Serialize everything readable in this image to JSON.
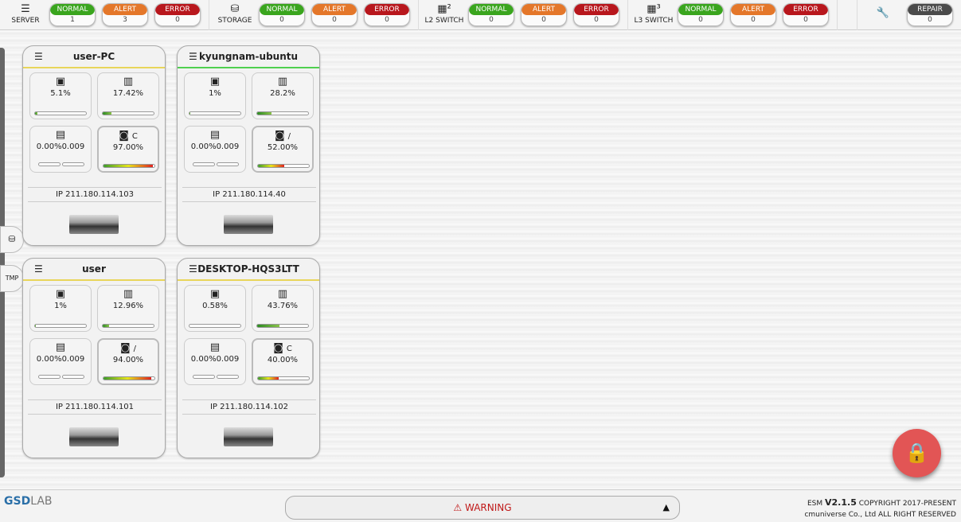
{
  "topbar": {
    "groups": [
      {
        "label": "SERVER",
        "icon": "server-icon",
        "glyph": "☰",
        "counts": [
          {
            "label": "NORMAL",
            "value": "1",
            "cls": "n"
          },
          {
            "label": "ALERT",
            "value": "3",
            "cls": "a"
          },
          {
            "label": "ERROR",
            "value": "0",
            "cls": "e"
          }
        ]
      },
      {
        "label": "STORAGE",
        "icon": "storage-icon",
        "glyph": "⛁",
        "counts": [
          {
            "label": "NORMAL",
            "value": "0",
            "cls": "n"
          },
          {
            "label": "ALERT",
            "value": "0",
            "cls": "a"
          },
          {
            "label": "ERROR",
            "value": "0",
            "cls": "e"
          }
        ]
      },
      {
        "label": "L2 SWITCH",
        "icon": "switch-l2-icon",
        "glyph": "▦²",
        "counts": [
          {
            "label": "NORMAL",
            "value": "0",
            "cls": "n"
          },
          {
            "label": "ALERT",
            "value": "0",
            "cls": "a"
          },
          {
            "label": "ERROR",
            "value": "0",
            "cls": "e"
          }
        ]
      },
      {
        "label": "L3 SWITCH",
        "icon": "switch-l3-icon",
        "glyph": "▦³",
        "counts": [
          {
            "label": "NORMAL",
            "value": "0",
            "cls": "n"
          },
          {
            "label": "ALERT",
            "value": "0",
            "cls": "a"
          },
          {
            "label": "ERROR",
            "value": "0",
            "cls": "e"
          }
        ]
      },
      {
        "label": "",
        "icon": "wrench-icon",
        "glyph": "🔧",
        "counts": [
          {
            "label": "REPAIR",
            "value": "0",
            "cls": "r"
          }
        ]
      }
    ]
  },
  "cards": [
    {
      "name": "user-PC",
      "status_color": "#e8d55a",
      "cpu": "5.1%",
      "cpu_pct": 5.1,
      "mem": "17.42%",
      "mem_pct": 17.42,
      "net": "0.00%0.009",
      "disk_label": "C",
      "disk": "97.00%",
      "disk_pct": 97,
      "ip_label": "IP",
      "ip": "211.180.114.103"
    },
    {
      "name": "kyungnam-ubuntu",
      "status_color": "#4fd04f",
      "cpu": "1%",
      "cpu_pct": 1,
      "mem": "28.2%",
      "mem_pct": 28.2,
      "net": "0.00%0.009",
      "disk_label": "/",
      "disk": "52.00%",
      "disk_pct": 52,
      "ip_label": "IP",
      "ip": "211.180.114.40"
    },
    {
      "name": "user",
      "status_color": "#e8d55a",
      "cpu": "1%",
      "cpu_pct": 1,
      "mem": "12.96%",
      "mem_pct": 12.96,
      "net": "0.00%0.009",
      "disk_label": "/",
      "disk": "94.00%",
      "disk_pct": 94,
      "ip_label": "IP",
      "ip": "211.180.114.101"
    },
    {
      "name": "DESKTOP-HQS3LTT",
      "status_color": "#e8d55a",
      "cpu": "0.58%",
      "cpu_pct": 0.58,
      "mem": "43.76%",
      "mem_pct": 43.76,
      "net": "0.00%0.009",
      "disk_label": "C",
      "disk": "40.00%",
      "disk_pct": 40,
      "ip_label": "IP",
      "ip": "211.180.114.102"
    }
  ],
  "side": {
    "search_label": "",
    "tmp_label": "TMP"
  },
  "footer": {
    "logo_a": "GSD",
    "logo_b": "LAB",
    "warning": "WARNING",
    "version_prefix": "ESM",
    "version": "V2.1.5",
    "copyright": "COPYRIGHT 2017-PRESENT",
    "company": "cmuniverse Co., Ltd ALL RIGHT RESERVED"
  }
}
